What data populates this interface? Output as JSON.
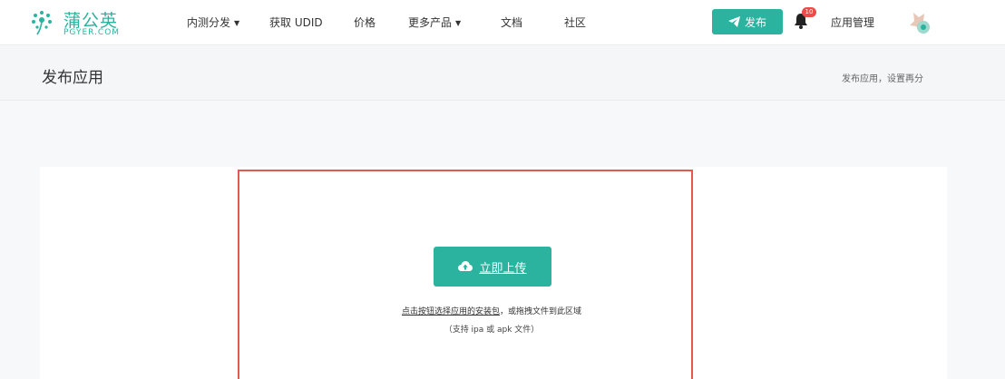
{
  "brand": {
    "name": "蒲公英",
    "domain": "PGYER.COM",
    "accent_color": "#2bb3a0"
  },
  "nav": {
    "items": [
      {
        "label": "内测分发",
        "has_dropdown": true
      },
      {
        "label": "获取 UDID",
        "has_dropdown": false
      },
      {
        "label": "价格",
        "has_dropdown": false
      },
      {
        "label": "更多产品",
        "has_dropdown": true
      },
      {
        "label": "文档",
        "has_dropdown": false
      },
      {
        "label": "社区",
        "has_dropdown": false
      }
    ],
    "publish_label": "发布",
    "notification_count": "10",
    "app_manage_label": "应用管理"
  },
  "page": {
    "title": "发布应用",
    "breadcrumb": {
      "item1": "发布应用",
      "separator": "，",
      "item2": "设置再分"
    }
  },
  "upload": {
    "button_label": "立即上传",
    "hint_link": "点击按钮选择应用的安装包",
    "hint_rest": "，或拖拽文件到此区域",
    "supported": "（支持 ipa 或 apk 文件）",
    "border_color": "#e05a4f"
  }
}
